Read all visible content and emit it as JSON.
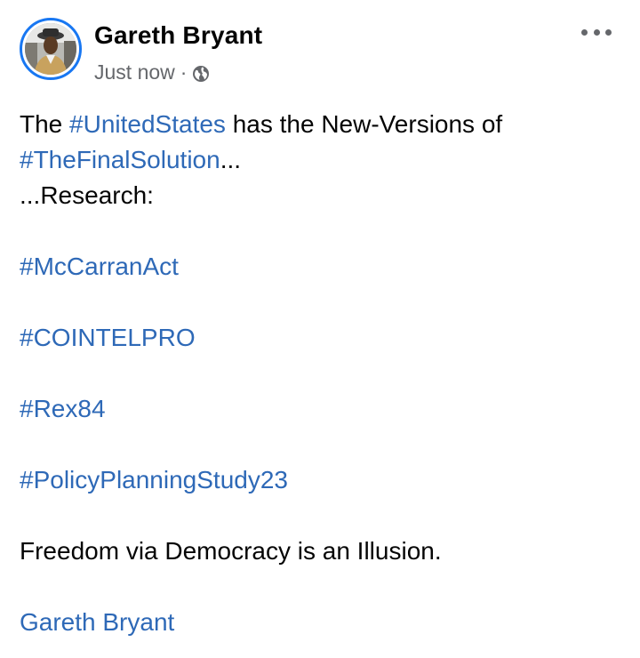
{
  "post": {
    "author": "Gareth Bryant",
    "timestamp": "Just now",
    "separator": "·",
    "privacy_icon": "globe-icon",
    "more_icon": "more-options-icon",
    "intro": {
      "prefix": "The ",
      "tag1": "#UnitedStates",
      "middle": " has the New-Versions of",
      "tag2": "#TheFinalSolution",
      "suffix": "..."
    },
    "research_line": "...Research:",
    "hashtags": [
      "#McCarranAct",
      "#COINTELPRO",
      "#Rex84",
      "#PolicyPlanningStudy23"
    ],
    "closing": "Freedom via Democracy is an Illusion.",
    "signature": "Gareth Bryant"
  },
  "colors": {
    "link": "#2e69b7",
    "text": "#050505",
    "meta": "#65676b",
    "avatar_ring": "#1877f2"
  }
}
